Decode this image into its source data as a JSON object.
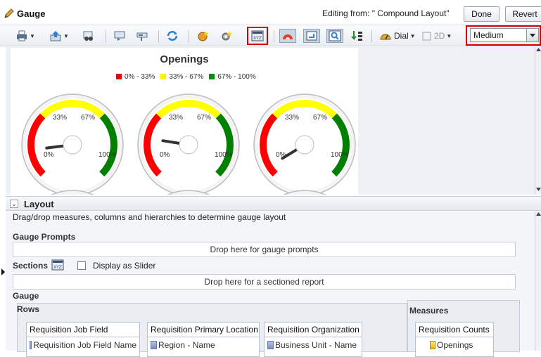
{
  "header": {
    "title": "Gauge",
    "editing_from": "Editing from: \" Compound Layout\"",
    "done_label": "Done",
    "revert_label": "Revert"
  },
  "toolbar": {
    "icons": [
      "print-icon",
      "export-icon",
      "preview-icon",
      "properties-icon",
      "format-icon",
      "refresh-icon",
      "new-icon",
      "settings-icon",
      "sections-icon",
      "gauge-type-icon",
      "edit-icon",
      "zoom-icon",
      "sort-icon"
    ],
    "dial_label": "Dial",
    "dimension_label": "2D",
    "size_value": "Medium"
  },
  "chart": {
    "title": "Openings",
    "legend": [
      {
        "label": "0% - 33%",
        "color": "#ff0000"
      },
      {
        "label": "33% - 67%",
        "color": "#ffff00"
      },
      {
        "label": "67% - 100%",
        "color": "#008000"
      }
    ],
    "tick_labels": {
      "t0": "0%",
      "t33": "33%",
      "t67": "67%",
      "t100": "100%"
    }
  },
  "chart_data": {
    "type": "gauge",
    "title": "Openings",
    "ranges": [
      {
        "label": "0% - 33%",
        "from": 0,
        "to": 33,
        "color": "#ff0000"
      },
      {
        "label": "33% - 67%",
        "from": 33,
        "to": 67,
        "color": "#ffff00"
      },
      {
        "label": "67% - 100%",
        "from": 67,
        "to": 100,
        "color": "#008000"
      }
    ],
    "gauges": [
      {
        "value": 14
      },
      {
        "value": 20
      },
      {
        "value": 5
      }
    ]
  },
  "layout": {
    "section_title": "Layout",
    "hint": "Drag/drop measures, columns and hierarchies to determine gauge layout",
    "gauge_prompts_label": "Gauge Prompts",
    "gauge_prompts_drop": "Drop here for gauge prompts",
    "sections_label": "Sections",
    "display_as_slider": "Display as Slider",
    "sections_drop": "Drop here for a sectioned report",
    "gauge_label": "Gauge",
    "rows_label": "Rows",
    "measures_label": "Measures",
    "rows": [
      {
        "header": "Requisition Job Field",
        "item": "Requisition Job Field Name"
      },
      {
        "header": "Requisition Primary Location",
        "item": "Region - Name"
      },
      {
        "header": "Requisition Organization",
        "item": "Business Unit - Name"
      }
    ],
    "measures": [
      {
        "header": "Requisition Counts",
        "item": "Openings"
      }
    ]
  }
}
